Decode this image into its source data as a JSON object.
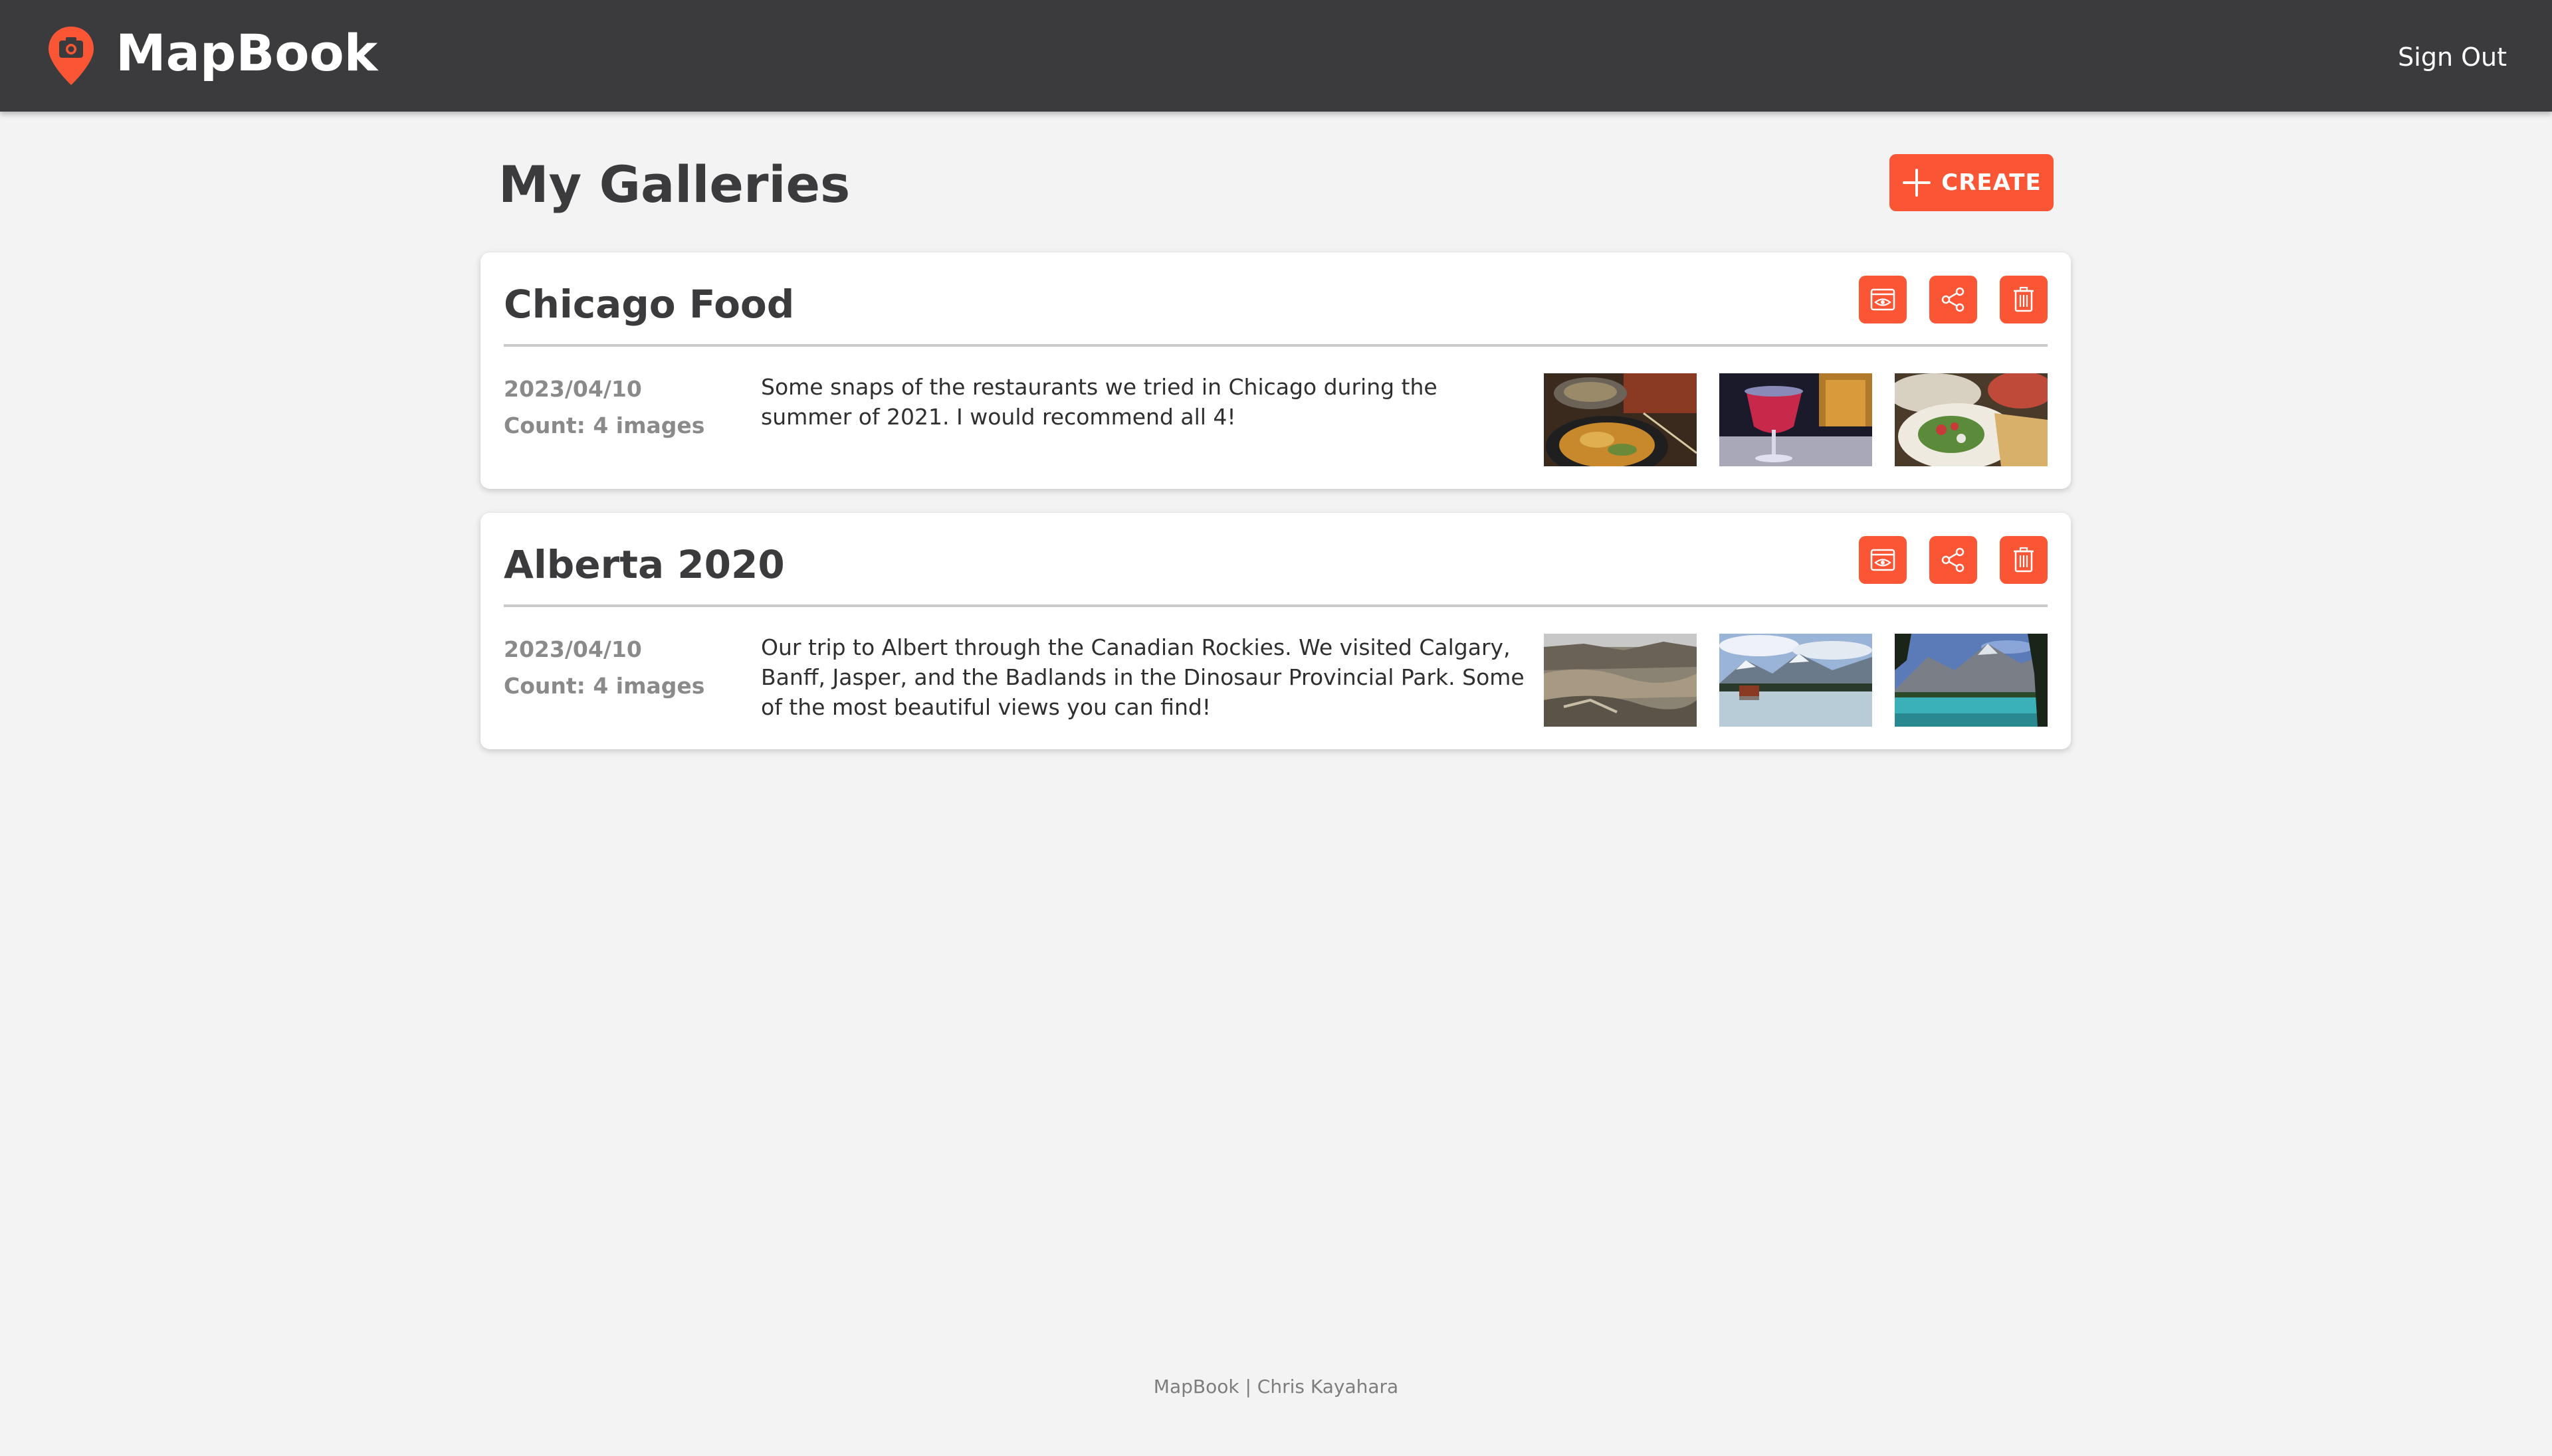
{
  "header": {
    "app_title": "MapBook",
    "signout_label": "Sign Out",
    "logo_icon": "map-pin-camera-icon"
  },
  "page": {
    "title": "My Galleries",
    "create_label": "CREATE"
  },
  "galleries": [
    {
      "title": "Chicago Food",
      "date": "2023/04/10",
      "count": "Count: 4 images",
      "description": "Some snaps of the restaurants we tried in Chicago during the summer of 2021. I would recommend all 4!",
      "actions": [
        "view-icon",
        "share-icon",
        "trash-icon"
      ],
      "thumbnails": [
        "food-bowl-photo",
        "cocktail-drink-photo",
        "salad-plate-photo"
      ]
    },
    {
      "title": "Alberta 2020",
      "date": "2023/04/10",
      "count": "Count: 4 images",
      "description": "Our trip to Albert through the Canadian Rockies. We visited Calgary, Banff, Jasper, and the Badlands in the Dinosaur Provincial Park. Some of the most beautiful views you can find!",
      "actions": [
        "view-icon",
        "share-icon",
        "trash-icon"
      ],
      "thumbnails": [
        "badlands-photo",
        "mountain-lake-boathouse-photo",
        "turquoise-lake-mountains-photo"
      ]
    }
  ],
  "footer": {
    "text": "MapBook | Chris Kayahara"
  },
  "colors": {
    "accent": "#fa5535",
    "topbar": "#3b3b3d",
    "background": "#f3f3f3"
  }
}
